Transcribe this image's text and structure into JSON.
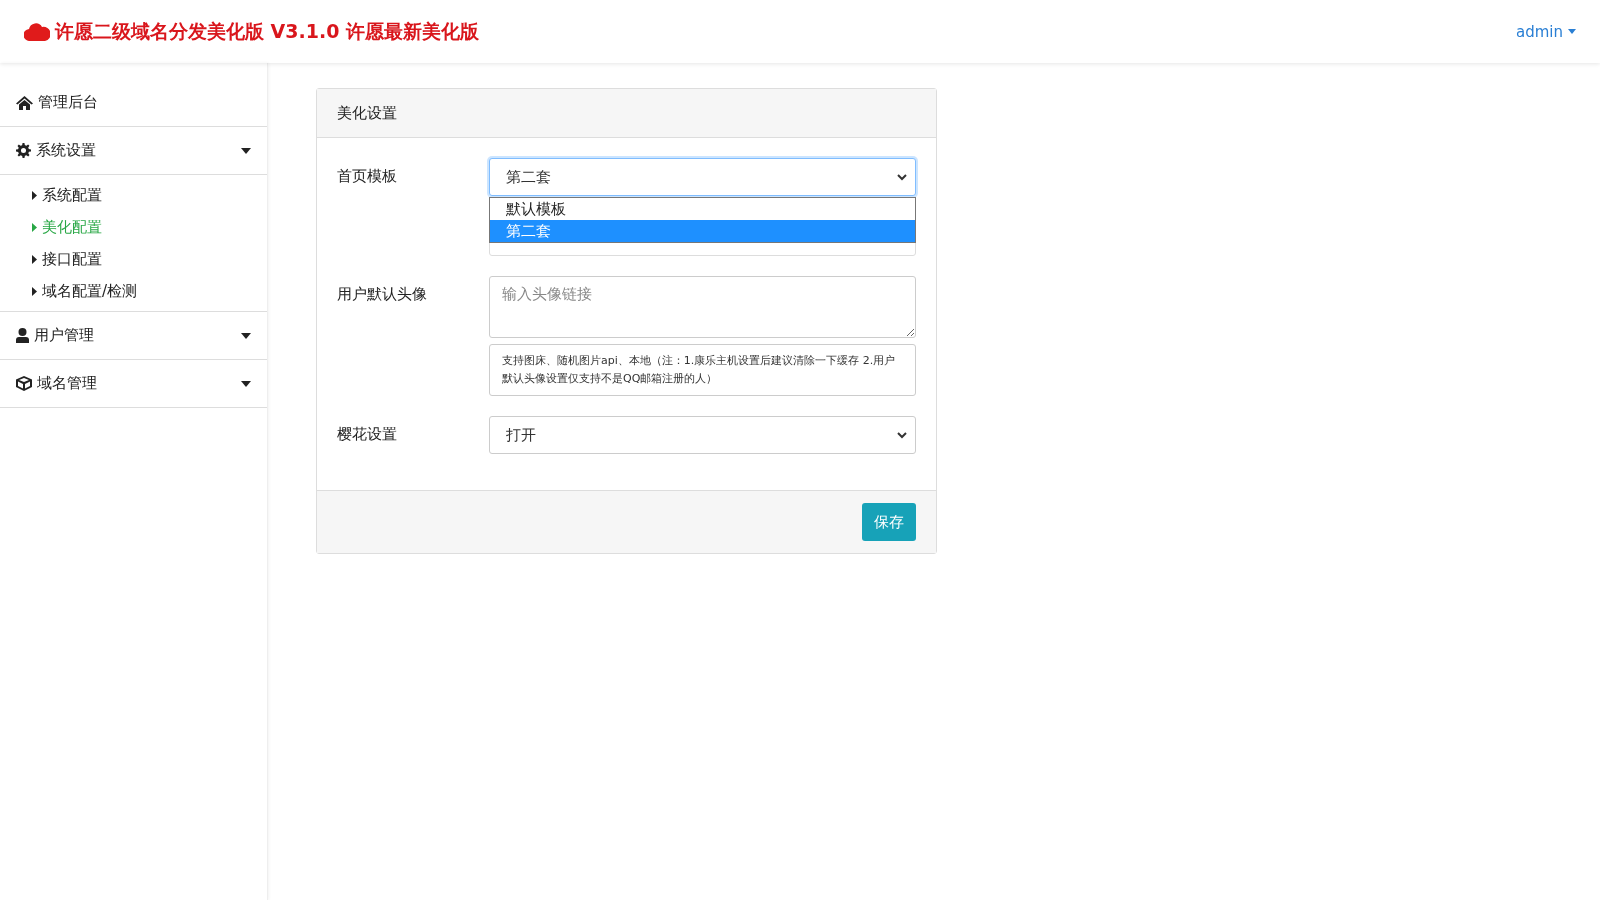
{
  "header": {
    "title": "许愿二级域名分发美化版 V3.1.0 许愿最新美化版",
    "user": "admin"
  },
  "sidebar": {
    "items": [
      {
        "label": "管理后台",
        "kind": "link"
      },
      {
        "label": "系统设置",
        "kind": "group",
        "expanded": true,
        "children": [
          {
            "label": "系统配置",
            "selected": false
          },
          {
            "label": "美化配置",
            "selected": true
          },
          {
            "label": "接口配置",
            "selected": false
          },
          {
            "label": "域名配置/检测",
            "selected": false
          }
        ]
      },
      {
        "label": "用户管理",
        "kind": "group"
      },
      {
        "label": "域名管理",
        "kind": "group"
      }
    ]
  },
  "card": {
    "title": "美化设置",
    "fields": [
      {
        "label": "首页模板",
        "kind": "select",
        "value": "第二套",
        "open": true,
        "options": [
          {
            "label": "默认模板",
            "selected": false
          },
          {
            "label": "第二套",
            "selected": true
          }
        ]
      },
      {
        "label": "用户默认头像",
        "kind": "textarea",
        "placeholder": "输入头像链接",
        "hint": "支持图床、随机图片api、本地（注：1.康乐主机设置后建议清除一下缓存 2.用户默认头像设置仅支持不是QQ邮箱注册的人）"
      },
      {
        "label": "樱花设置",
        "kind": "select",
        "value": "打开",
        "open": false
      }
    ],
    "save": "保存"
  }
}
